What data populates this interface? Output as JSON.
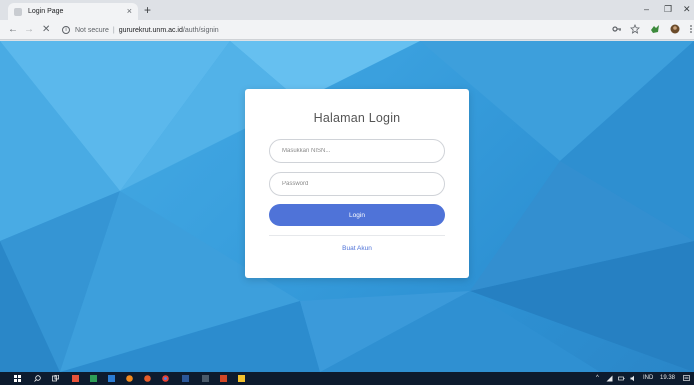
{
  "browser": {
    "tab": {
      "title": "Login Page",
      "close_glyph": "×"
    },
    "new_tab_glyph": "+",
    "window_controls": {
      "minimize": "–",
      "restore": "❐",
      "close": "✕"
    },
    "nav": {
      "back": "←",
      "forward": "→",
      "reload": "✕"
    },
    "omnibox": {
      "info_glyph": "i",
      "security_text": "Not secure",
      "separator": "|",
      "host": "gururekrut.unm.ac.id",
      "path": "/auth/signin"
    },
    "toolbar_icons": [
      "key-icon",
      "star-icon",
      "extension-icon",
      "profile-avatar",
      "menu-icon"
    ]
  },
  "login": {
    "title": "Halaman Login",
    "nisn_placeholder": "Masukkan NISN...",
    "password_placeholder": "Password",
    "login_button": "Login",
    "create_account_link": "Buat Akun",
    "accent_color": "#4f73d8"
  },
  "taskbar": {
    "tray": {
      "chevron": "^",
      "language": "IND",
      "time": "19.38"
    }
  }
}
